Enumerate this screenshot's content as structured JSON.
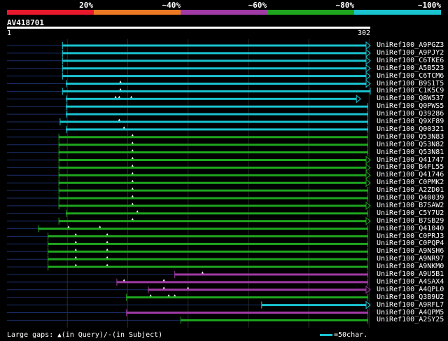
{
  "legend": {
    "labels": [
      "20%",
      "~40%",
      "~60%",
      "~80%",
      "~100%"
    ],
    "colors": [
      "#e8192c",
      "#ec7a24",
      "#a03aa5",
      "#1ea51e",
      "#19c3cf"
    ]
  },
  "query": {
    "id": "AV418701",
    "start": "1",
    "end": "302"
  },
  "chart_data": {
    "type": "alignment-overview",
    "query_length": 302,
    "hits": [
      {
        "name": "UniRef100_A9PGZ3",
        "start": 47,
        "end": 302,
        "identity": "~100%",
        "arrow": true,
        "gaps": []
      },
      {
        "name": "UniRef100_A9PJY2",
        "start": 47,
        "end": 302,
        "identity": "~100%",
        "arrow": true,
        "gaps": []
      },
      {
        "name": "UniRef100_C6TKE6",
        "start": 47,
        "end": 302,
        "identity": "~100%",
        "arrow": true,
        "gaps": []
      },
      {
        "name": "UniRef100_A5B523",
        "start": 47,
        "end": 302,
        "identity": "~100%",
        "arrow": true,
        "gaps": []
      },
      {
        "name": "UniRef100_C6TCM6",
        "start": 47,
        "end": 302,
        "identity": "~100%",
        "arrow": true,
        "gaps": []
      },
      {
        "name": "UniRef100_B9S1T5",
        "start": 50,
        "end": 302,
        "identity": "~100%",
        "arrow": true,
        "gaps": [
          95
        ]
      },
      {
        "name": "UniRef100_C1K5C9",
        "start": 47,
        "end": 302,
        "identity": "~100%",
        "arrow": false,
        "gaps": [
          95
        ]
      },
      {
        "name": "UniRef100_Q8W537",
        "start": 50,
        "end": 294,
        "identity": "~100%",
        "arrow": true,
        "gaps": [
          91,
          94,
          104
        ]
      },
      {
        "name": "UniRef100_Q0PWS5",
        "start": 50,
        "end": 300,
        "identity": "~100%",
        "arrow": false,
        "gaps": []
      },
      {
        "name": "UniRef100_Q39286",
        "start": 50,
        "end": 300,
        "identity": "~100%",
        "arrow": false,
        "gaps": []
      },
      {
        "name": "UniRef100_Q9XF89",
        "start": 45,
        "end": 300,
        "identity": "~100%",
        "arrow": false,
        "gaps": [
          94
        ]
      },
      {
        "name": "UniRef100_Q00321",
        "start": 50,
        "end": 300,
        "identity": "~100%",
        "arrow": false,
        "gaps": [
          98
        ]
      },
      {
        "name": "UniRef100_Q53N83",
        "start": 44,
        "end": 300,
        "identity": "~80%",
        "arrow": false,
        "gaps": [
          105
        ]
      },
      {
        "name": "UniRef100_Q53N82",
        "start": 44,
        "end": 300,
        "identity": "~80%",
        "arrow": false,
        "gaps": [
          105
        ]
      },
      {
        "name": "UniRef100_Q53N81",
        "start": 44,
        "end": 300,
        "identity": "~80%",
        "arrow": false,
        "gaps": [
          105
        ]
      },
      {
        "name": "UniRef100_Q41747",
        "start": 44,
        "end": 302,
        "identity": "~80%",
        "arrow": true,
        "gaps": [
          105
        ]
      },
      {
        "name": "UniRef100_B4FL55",
        "start": 44,
        "end": 302,
        "identity": "~80%",
        "arrow": true,
        "gaps": [
          105
        ]
      },
      {
        "name": "UniRef100_Q41746",
        "start": 44,
        "end": 302,
        "identity": "~80%",
        "arrow": true,
        "gaps": [
          105
        ]
      },
      {
        "name": "UniRef100_C0PMK2",
        "start": 44,
        "end": 302,
        "identity": "~80%",
        "arrow": true,
        "gaps": [
          105
        ]
      },
      {
        "name": "UniRef100_A2ZD01",
        "start": 44,
        "end": 300,
        "identity": "~80%",
        "arrow": false,
        "gaps": [
          105
        ]
      },
      {
        "name": "UniRef100_Q40039",
        "start": 44,
        "end": 300,
        "identity": "~80%",
        "arrow": false,
        "gaps": [
          105
        ]
      },
      {
        "name": "UniRef100_B7SAW2",
        "start": 44,
        "end": 302,
        "identity": "~80%",
        "arrow": true,
        "gaps": [
          105
        ]
      },
      {
        "name": "UniRef100_C5Y7U2",
        "start": 50,
        "end": 300,
        "identity": "~80%",
        "arrow": false,
        "gaps": [
          109
        ]
      },
      {
        "name": "UniRef100_B7SB29",
        "start": 44,
        "end": 302,
        "identity": "~80%",
        "arrow": true,
        "gaps": [
          105
        ]
      },
      {
        "name": "UniRef100_Q41040",
        "start": 27,
        "end": 300,
        "identity": "~80%",
        "arrow": false,
        "gaps": [
          52,
          78
        ]
      },
      {
        "name": "UniRef100_C0PRJ3",
        "start": 35,
        "end": 300,
        "identity": "~80%",
        "arrow": false,
        "gaps": [
          58,
          84
        ]
      },
      {
        "name": "UniRef100_C0PQP4",
        "start": 35,
        "end": 300,
        "identity": "~80%",
        "arrow": false,
        "gaps": [
          58,
          84
        ]
      },
      {
        "name": "UniRef100_A9NSH6",
        "start": 35,
        "end": 300,
        "identity": "~80%",
        "arrow": false,
        "gaps": [
          58,
          84
        ]
      },
      {
        "name": "UniRef100_A9NR97",
        "start": 35,
        "end": 300,
        "identity": "~80%",
        "arrow": false,
        "gaps": [
          58,
          84
        ]
      },
      {
        "name": "UniRef100_A9NKM0",
        "start": 35,
        "end": 300,
        "identity": "~80%",
        "arrow": false,
        "gaps": [
          58,
          84
        ]
      },
      {
        "name": "UniRef100_A9U5B1",
        "start": 140,
        "end": 300,
        "identity": "~60%",
        "arrow": false,
        "gaps": [
          163
        ]
      },
      {
        "name": "UniRef100_A4SAX4",
        "start": 92,
        "end": 300,
        "identity": "~60%",
        "arrow": false,
        "gaps": [
          98,
          131
        ]
      },
      {
        "name": "UniRef100_A4QPL0",
        "start": 118,
        "end": 302,
        "identity": "~60%",
        "arrow": true,
        "gaps": [
          131,
          151
        ]
      },
      {
        "name": "UniRef100_Q3B9U2",
        "start": 100,
        "end": 300,
        "identity": "~80%",
        "arrow": false,
        "gaps": [
          120,
          135,
          140
        ]
      },
      {
        "name": "UniRef100_A9RFL7",
        "start": 212,
        "end": 302,
        "identity": "~100%",
        "arrow": true,
        "gaps": []
      },
      {
        "name": "UniRef100_A4QPM5",
        "start": 100,
        "end": 300,
        "identity": "~60%",
        "arrow": false,
        "gaps": []
      },
      {
        "name": "UniRef100_A2SY25",
        "start": 145,
        "end": 300,
        "identity": "~80%",
        "arrow": false,
        "gaps": []
      }
    ]
  },
  "footer": {
    "gaps_label": "Large gaps:",
    "query_gap_label": "(in Query)/",
    "subject_gap_label": "(in Subject)",
    "scale_label": "=50char."
  }
}
